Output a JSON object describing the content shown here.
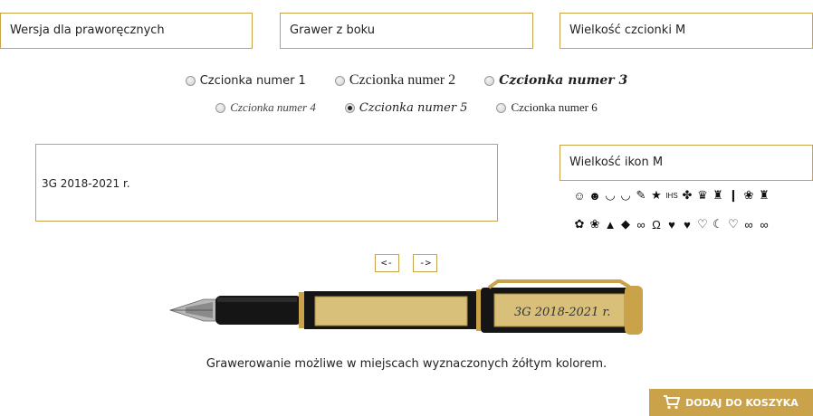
{
  "selects": {
    "hand_version": "Wersja dla praworęcznych",
    "engraving_side": "Grawer z boku",
    "font_size": "Wielkość czcionki M",
    "icon_size": "Wielkość ikon M"
  },
  "fonts": {
    "selected_index": 4,
    "options": [
      "Czcionka numer 1",
      "Czcionka numer 2",
      "Czcionka numer 3",
      "Czcionka numer 4",
      "Czcionka numer 5",
      "Czcionka numer 6"
    ]
  },
  "engraving_text": "3G 2018-2021 r.",
  "icons": {
    "row1": [
      "☺",
      "☻",
      "◡",
      "◡",
      "✎",
      "★",
      "IHS",
      "✤",
      "♛",
      "♜",
      "❙",
      "❀",
      "♜"
    ],
    "row2": [
      "✿",
      "❀",
      "▲",
      "◆",
      "∞",
      "Ω",
      "♥",
      "♥",
      "♡",
      "☾",
      "♡",
      "∞",
      "∞"
    ]
  },
  "nav": {
    "prev": "<-",
    "next": "->"
  },
  "pen_preview_text": "3G 2018-2021 r.",
  "caption": "Grawerowanie możliwe w miejscach wyznaczonych żółtym kolorem.",
  "cart_button": "DODAJ DO KOSZYKA",
  "colors": {
    "accent": "#c9a24a",
    "pen_body": "#151515",
    "engrave_area": "#d8bf7a"
  }
}
